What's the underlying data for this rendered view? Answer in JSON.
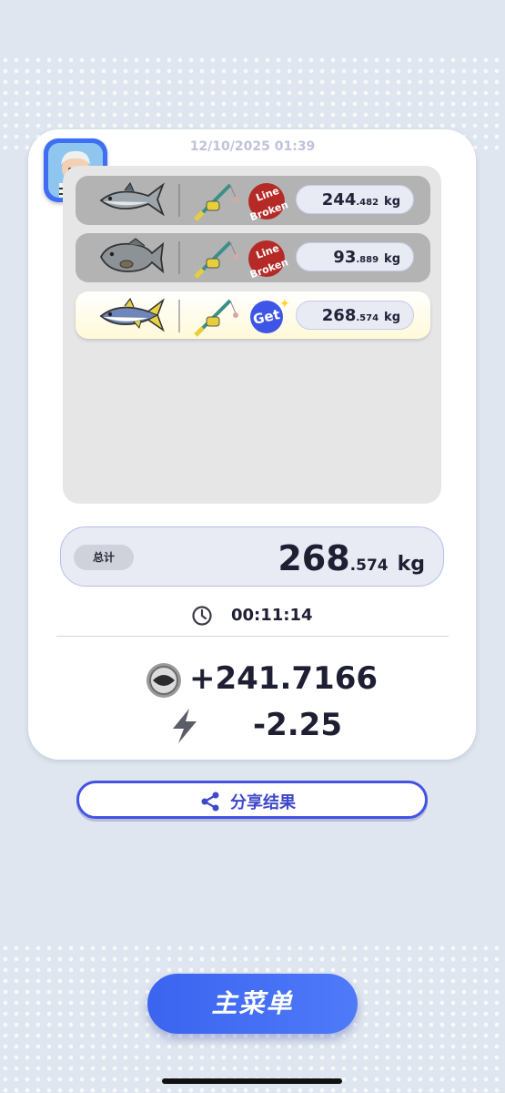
{
  "timestamp": "12/10/2025 01:39",
  "catches": [
    {
      "status": "failed",
      "fish_icon": "tuna-icon",
      "rod_icon": "fishing-rod-icon",
      "badge_line1": "Line",
      "badge_line2": "Broken",
      "weight_int": "244",
      "weight_dec": ".482",
      "unit": "kg"
    },
    {
      "status": "failed",
      "fish_icon": "grouper-icon",
      "rod_icon": "fishing-rod-icon",
      "badge_line1": "Line",
      "badge_line2": "Broken",
      "weight_int": "93",
      "weight_dec": ".889",
      "unit": "kg"
    },
    {
      "status": "success",
      "fish_icon": "tuna-icon",
      "rod_icon": "fishing-rod-icon",
      "badge": "Get",
      "weight_int": "268",
      "weight_dec": ".574",
      "unit": "kg"
    }
  ],
  "total": {
    "label": "总计",
    "weight_int": "268",
    "weight_dec": ".574",
    "unit": "kg"
  },
  "duration": "00:11:14",
  "coins_delta": "+241.7166",
  "energy_delta": "-2.25",
  "share_button": "分享结果",
  "main_menu_button": "主菜单",
  "colors": {
    "accent": "#4453e6",
    "line_broken": "#b52a27",
    "get_badge": "#3f55e7"
  }
}
